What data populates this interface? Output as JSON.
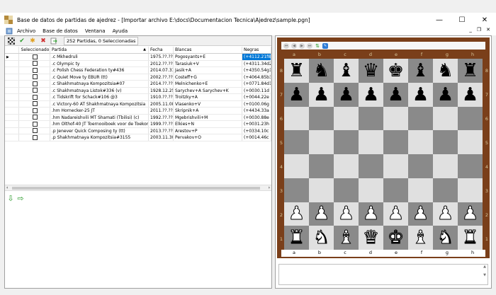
{
  "window": {
    "title": "Base de datos de partidas de ajedrez - [Importar archivo E:\\docs\\Documentacion Tecnica\\Ajedrez\\sample.pgn]",
    "minimize": "—",
    "maximize": "☐",
    "close": "✕"
  },
  "menu": {
    "items": [
      "Archivo",
      "Base de datos",
      "Ventana",
      "Ayuda"
    ],
    "mdi_minimize": "_",
    "mdi_restore": "❐",
    "mdi_close": "✕"
  },
  "toolbar": {
    "count_label": "252 Partidas, 0 Seleccionadas"
  },
  "grid": {
    "columns": [
      "Seleccionado",
      "Partida",
      "Fecha",
      "Blancas",
      "Negras"
    ],
    "rows": [
      {
        "partida": ".c Mkhedruli",
        "fecha": "1975.??.??",
        "blancas": "Pogosyants+E",
        "negras": "(+4112.21f8",
        "selected": true
      },
      {
        "partida": ".c Olympic ty",
        "fecha": "2012.??.??",
        "blancas": "Tarasiuk+V",
        "negras": "(+4311.34d2"
      },
      {
        "partida": ".c Polish Chess Federation ty#436",
        "fecha": "2014.07.31",
        "blancas": "Jasik+A",
        "negras": "(+4350.54g1"
      },
      {
        "partida": ".c Quiet Move ty EBUR (tt)",
        "fecha": "2002.??.??",
        "blancas": "Costeff+G",
        "negras": "(+4064.85b3"
      },
      {
        "partida": ".c Shakhmatnaya Kompozitsia#07",
        "fecha": "2014.??.??",
        "blancas": "Melnichenko+E",
        "negras": "(+0771.84d1"
      },
      {
        "partida": ".c Shakhmatnaya Listok#336 (v)",
        "fecha": "1928.12.25",
        "blancas": "Sarychev+A Sarychev+K",
        "negras": "(+0030.11d"
      },
      {
        "partida": ".c Tidskrift for Schack#106 @3",
        "fecha": "1910.??.??",
        "blancas": "Troitzky+A",
        "negras": "(+0044.22e"
      },
      {
        "partida": ".c Victory-60 AT Shakhmatnaya Kompozitsia",
        "fecha": "2005.11.08",
        "blancas": "Vlasenko+V",
        "negras": "(+0100.06g"
      },
      {
        "partida": ".hm Hornecker-25 JT",
        "fecha": "2011.??.??",
        "blancas": "Skripnik+A",
        "negras": "(+4434.33a"
      },
      {
        "partida": ".hm Nadareishvili MT Shamati (Tbilisi) (c)",
        "fecha": "1992.??.??",
        "blancas": "Mgebrishvili+M",
        "negras": "(+0030.88e"
      },
      {
        "partida": ".hm Olthof-40 JT Toernooiboek voor de Toekomst",
        "fecha": "1999.??.??",
        "blancas": "Elkies+N",
        "negras": "(+0031.23h"
      },
      {
        "partida": ".p Jenever Quick Composing ty (tt)",
        "fecha": "2013.??.??",
        "blancas": "Arestov+P",
        "negras": "(+0334.10c"
      },
      {
        "partida": ".p Shakhmatnaya Kompozitsia#3155",
        "fecha": "2003.11.30",
        "blancas": "Pervakov+O",
        "negras": "(+0014.46c"
      }
    ]
  },
  "board": {
    "files": [
      "a",
      "b",
      "c",
      "d",
      "e",
      "f",
      "g",
      "h"
    ],
    "ranks": [
      "8",
      "7",
      "6",
      "5",
      "4",
      "3",
      "2",
      "1"
    ],
    "position": [
      [
        "r",
        "n",
        "b",
        "q",
        "k",
        "b",
        "n",
        "r"
      ],
      [
        "p",
        "p",
        "p",
        "p",
        "p",
        "p",
        "p",
        "p"
      ],
      [
        "",
        "",
        "",
        "",
        "",
        "",
        "",
        ""
      ],
      [
        "",
        "",
        "",
        "",
        "",
        "",
        "",
        ""
      ],
      [
        "",
        "",
        "",
        "",
        "",
        "",
        "",
        ""
      ],
      [
        "",
        "",
        "",
        "",
        "",
        "",
        "",
        ""
      ],
      [
        "P",
        "P",
        "P",
        "P",
        "P",
        "P",
        "P",
        "P"
      ],
      [
        "R",
        "N",
        "B",
        "Q",
        "K",
        "B",
        "N",
        "R"
      ]
    ]
  }
}
